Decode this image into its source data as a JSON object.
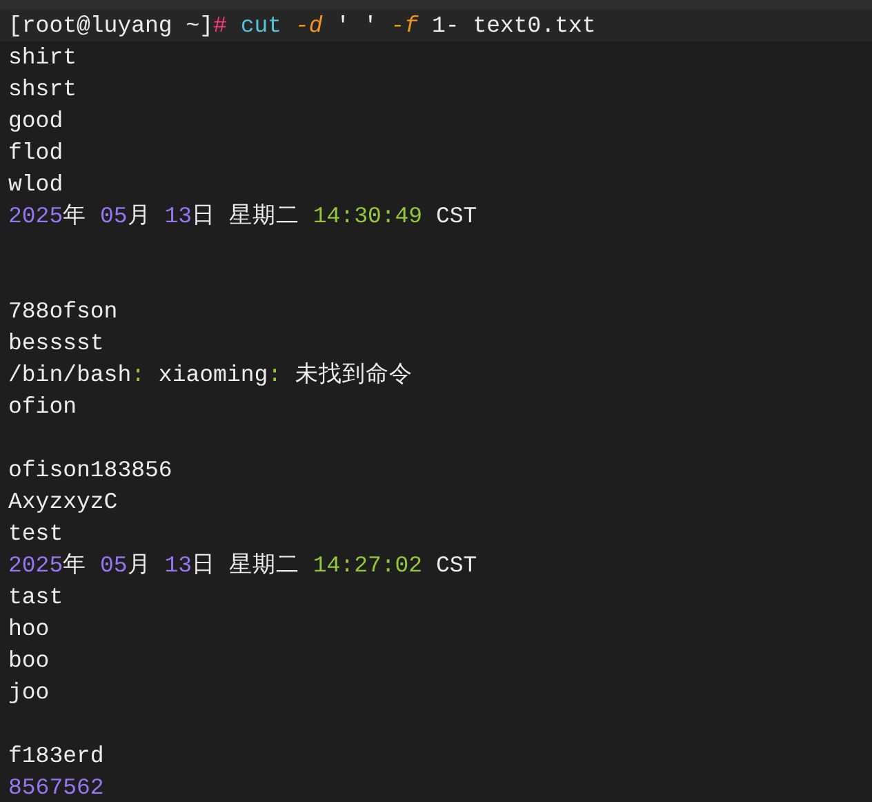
{
  "terminal": {
    "lines": [
      {
        "kind": "prompt",
        "segments": [
          {
            "kind": "text",
            "text": "[root@luyang ~]"
          },
          {
            "kind": "symbol",
            "text": "# "
          },
          {
            "kind": "command",
            "text": "cut "
          },
          {
            "kind": "option",
            "text": "-d"
          },
          {
            "kind": "text",
            "text": " ' ' "
          },
          {
            "kind": "option",
            "text": "-f"
          },
          {
            "kind": "text",
            "text": " 1- text0.txt"
          }
        ]
      },
      {
        "kind": "output",
        "segments": [
          {
            "kind": "text",
            "text": "shirt"
          }
        ]
      },
      {
        "kind": "output",
        "segments": [
          {
            "kind": "text",
            "text": "shsrt"
          }
        ]
      },
      {
        "kind": "output",
        "segments": [
          {
            "kind": "text",
            "text": "good"
          }
        ]
      },
      {
        "kind": "output",
        "segments": [
          {
            "kind": "text",
            "text": "flod"
          }
        ]
      },
      {
        "kind": "output",
        "segments": [
          {
            "kind": "text",
            "text": "wlod"
          }
        ]
      },
      {
        "kind": "output",
        "segments": [
          {
            "kind": "number",
            "text": "2025"
          },
          {
            "kind": "text",
            "text": "年 "
          },
          {
            "kind": "number",
            "text": "05"
          },
          {
            "kind": "text",
            "text": "月 "
          },
          {
            "kind": "number",
            "text": "13"
          },
          {
            "kind": "text",
            "text": "日 星期二 "
          },
          {
            "kind": "time",
            "text": "14:30:49"
          },
          {
            "kind": "text",
            "text": " CST"
          }
        ]
      },
      {
        "kind": "blank"
      },
      {
        "kind": "blank"
      },
      {
        "kind": "output",
        "segments": [
          {
            "kind": "text",
            "text": "788ofson"
          }
        ]
      },
      {
        "kind": "output",
        "segments": [
          {
            "kind": "text",
            "text": "besssst"
          }
        ]
      },
      {
        "kind": "output",
        "segments": [
          {
            "kind": "text",
            "text": "/bin/bash"
          },
          {
            "kind": "punct",
            "text": ":"
          },
          {
            "kind": "text",
            "text": " xiaoming"
          },
          {
            "kind": "punct",
            "text": ":"
          },
          {
            "kind": "text",
            "text": " 未找到命令"
          }
        ]
      },
      {
        "kind": "output",
        "segments": [
          {
            "kind": "text",
            "text": "ofion"
          }
        ]
      },
      {
        "kind": "blank"
      },
      {
        "kind": "output",
        "segments": [
          {
            "kind": "text",
            "text": "ofison183856"
          }
        ]
      },
      {
        "kind": "output",
        "segments": [
          {
            "kind": "text",
            "text": "AxyzxyzC"
          }
        ]
      },
      {
        "kind": "output",
        "segments": [
          {
            "kind": "text",
            "text": "test"
          }
        ]
      },
      {
        "kind": "output",
        "segments": [
          {
            "kind": "number",
            "text": "2025"
          },
          {
            "kind": "text",
            "text": "年 "
          },
          {
            "kind": "number",
            "text": "05"
          },
          {
            "kind": "text",
            "text": "月 "
          },
          {
            "kind": "number",
            "text": "13"
          },
          {
            "kind": "text",
            "text": "日 星期二 "
          },
          {
            "kind": "time",
            "text": "14:27:02"
          },
          {
            "kind": "text",
            "text": " CST"
          }
        ]
      },
      {
        "kind": "output",
        "segments": [
          {
            "kind": "text",
            "text": "tast"
          }
        ]
      },
      {
        "kind": "output",
        "segments": [
          {
            "kind": "text",
            "text": "hoo"
          }
        ]
      },
      {
        "kind": "output",
        "segments": [
          {
            "kind": "text",
            "text": "boo"
          }
        ]
      },
      {
        "kind": "output",
        "segments": [
          {
            "kind": "text",
            "text": "joo"
          }
        ]
      },
      {
        "kind": "blank"
      },
      {
        "kind": "output",
        "segments": [
          {
            "kind": "text",
            "text": "f183erd"
          }
        ]
      },
      {
        "kind": "output",
        "segments": [
          {
            "kind": "number",
            "text": "8567562"
          }
        ]
      }
    ]
  }
}
